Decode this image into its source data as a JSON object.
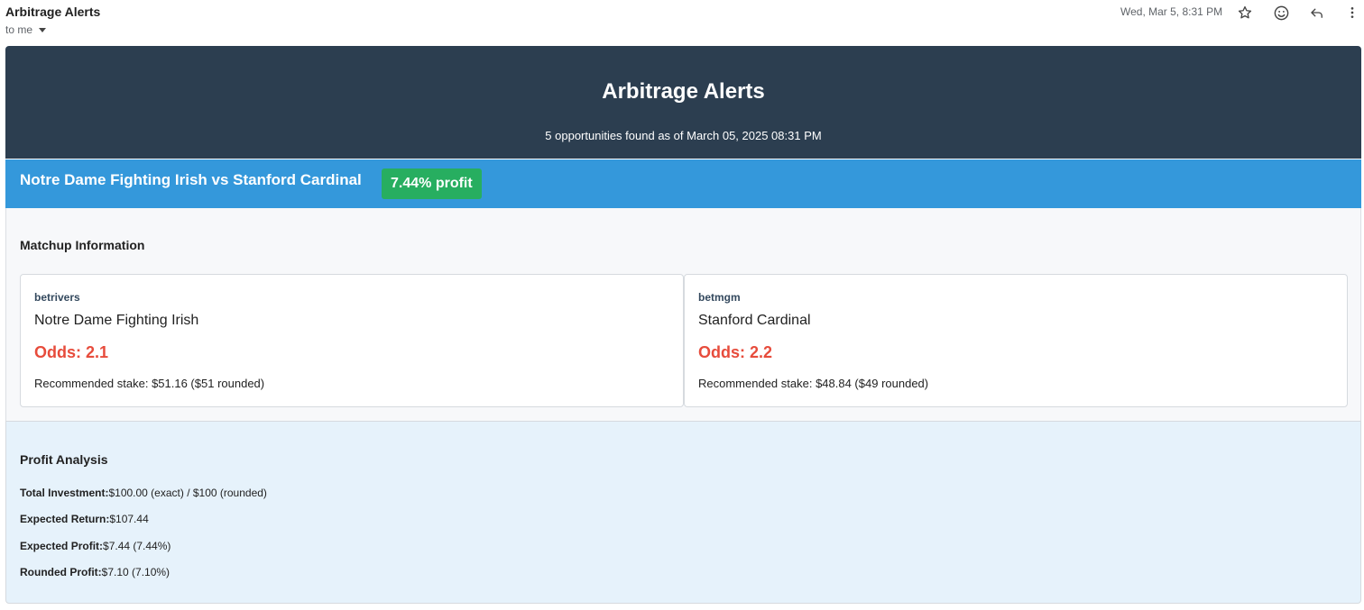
{
  "email": {
    "sender": "Arbitrage Alerts",
    "recipient": "to me",
    "date": "Wed, Mar 5, 8:31 PM",
    "icons": [
      "star-icon",
      "emoji-icon",
      "reply-icon",
      "more-vert-icon"
    ]
  },
  "banner": {
    "title": "Arbitrage Alerts",
    "subtitle": "5 opportunities found as of March 05, 2025 08:31 PM",
    "color": "#2c3e50"
  },
  "matchup": {
    "title": "Notre Dame Fighting Irish vs Stanford Cardinal",
    "profit_badge": "7.44% profit",
    "bar_color": "#3498db",
    "badge_color": "#27ae60",
    "section_title": "Matchup Information",
    "books": [
      {
        "sportsbook": "betrivers",
        "team": "Notre Dame Fighting Irish",
        "odds": "Odds: 2.1",
        "stake": "Recommended stake: $51.16 ($51 rounded)"
      },
      {
        "sportsbook": "betmgm",
        "team": "Stanford Cardinal",
        "odds": "Odds: 2.2",
        "stake": "Recommended stake: $48.84 ($49 rounded)"
      }
    ],
    "odds_color": "#e74c3c"
  },
  "profit_analysis": {
    "title": "Profit Analysis",
    "rows": [
      {
        "label": "Total Investment:",
        "value": "$100.00 (exact) / $100 (rounded)"
      },
      {
        "label": "Expected Return:",
        "value": "$107.44"
      },
      {
        "label": "Expected Profit:",
        "value": "$7.44 (7.44%)"
      },
      {
        "label": "Rounded Profit:",
        "value": "$7.10 (7.10%)"
      }
    ]
  }
}
